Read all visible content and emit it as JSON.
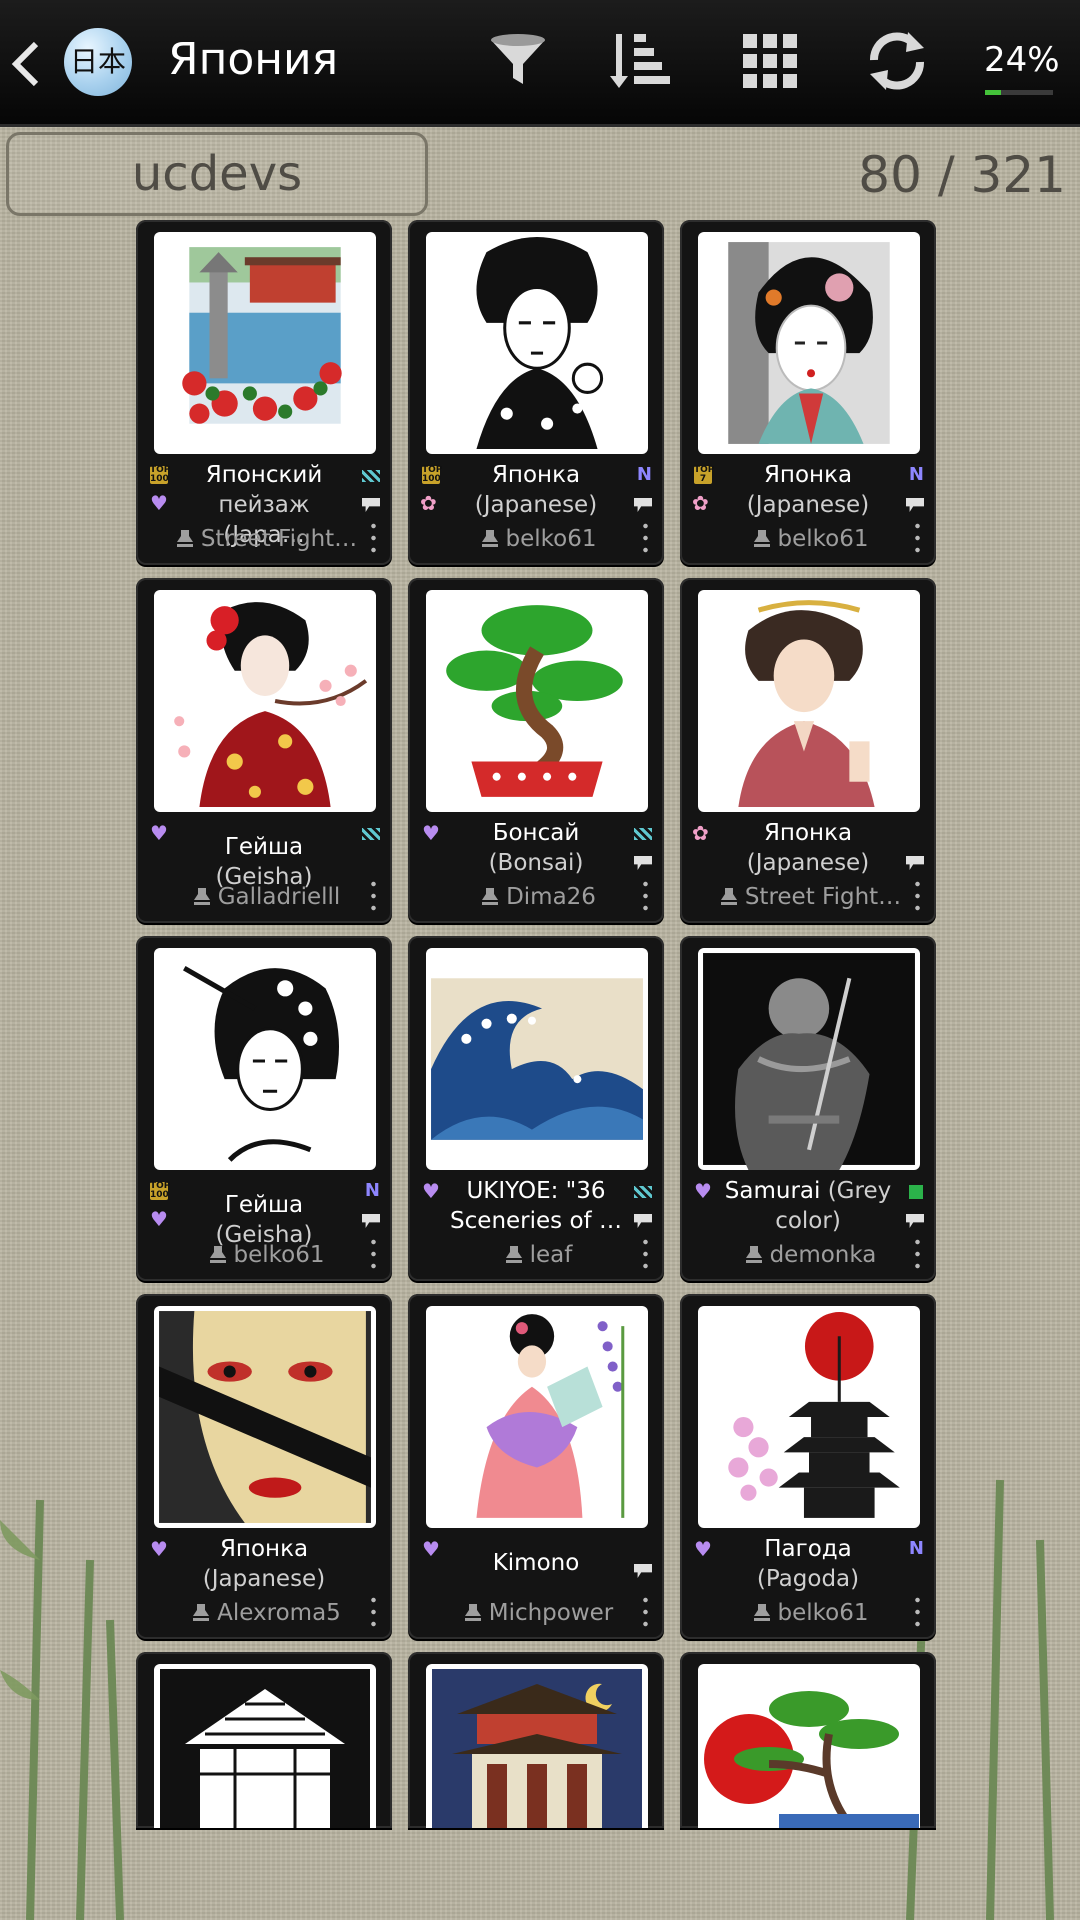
{
  "header": {
    "title": "Япония",
    "logo_text": "日本",
    "progress_percent_label": "24%",
    "progress_fraction": 0.24,
    "icons": [
      "back-icon",
      "filter-icon",
      "sort-icon",
      "grid-icon",
      "refresh-icon"
    ]
  },
  "search": {
    "value": "ucdevs"
  },
  "counter": "80 / 321",
  "cards": [
    {
      "title": "Японский",
      "subtitle": "пейзаж (Japa…",
      "author": "Street Fight…"
    },
    {
      "title": "Японка",
      "subtitle": "(Japanese)",
      "author": "belko61"
    },
    {
      "title": "Японка",
      "subtitle": "(Japanese)",
      "author": "belko61"
    },
    {
      "title": "Гейша",
      "subtitle": "(Geisha)",
      "author": "Galladrielll"
    },
    {
      "title": "Бонсай",
      "subtitle": "(Bonsai)",
      "author": "Dima26"
    },
    {
      "title": "Японка",
      "subtitle": "(Japanese)",
      "author": "Street Fight…"
    },
    {
      "title": "Гейша",
      "subtitle": "(Geisha)",
      "author": "belko61"
    },
    {
      "title": "UKIYOE: \"36",
      "subtitle": "Sceneries of …",
      "author": "leaf"
    },
    {
      "title": "Samurai",
      "subtitle": "(Grey color)",
      "author": "demonka"
    },
    {
      "title": "Японка",
      "subtitle": "(Japanese)",
      "author": "Alexroma5"
    },
    {
      "title": "Kimono",
      "subtitle": "",
      "author": "Michpower"
    },
    {
      "title": "Пагода",
      "subtitle": "(Pagoda)",
      "author": "belko61"
    }
  ],
  "badges": {
    "top_100": "TOP 100",
    "top_7": "TOP 7",
    "new": "N"
  },
  "colors": {
    "accent_green": "#44c23a",
    "card_bg": "#141414",
    "topbar_bg": "#0b0b0b"
  }
}
